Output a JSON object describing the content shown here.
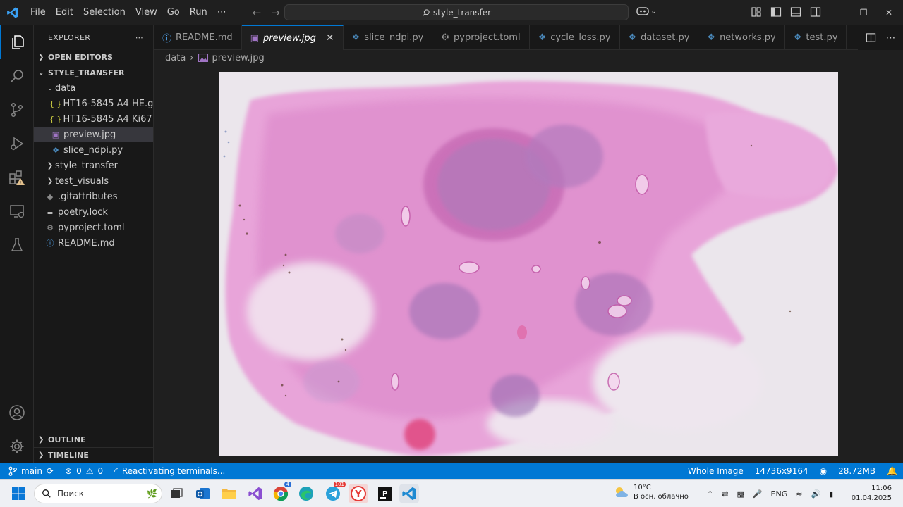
{
  "menu": [
    "File",
    "Edit",
    "Selection",
    "View",
    "Go",
    "Run",
    "⋯"
  ],
  "command_center": {
    "text": "style_transfer"
  },
  "explorer": {
    "title": "EXPLORER",
    "more": "⋯",
    "open_editors": "OPEN EDITORS",
    "root": "STYLE_TRANSFER",
    "tree": [
      {
        "label": "data",
        "kind": "folder-open",
        "indent": 1
      },
      {
        "label": "HT16-5845 A4 HE.g...",
        "kind": "json",
        "indent": 2
      },
      {
        "label": "HT16-5845 A4 Ki67....",
        "kind": "json",
        "indent": 2
      },
      {
        "label": "preview.jpg",
        "kind": "image",
        "indent": 2,
        "selected": true
      },
      {
        "label": "slice_ndpi.py",
        "kind": "python",
        "indent": 2
      },
      {
        "label": "style_transfer",
        "kind": "folder",
        "indent": 1
      },
      {
        "label": "test_visuals",
        "kind": "folder",
        "indent": 1
      },
      {
        "label": ".gitattributes",
        "kind": "git",
        "indent": 1
      },
      {
        "label": "poetry.lock",
        "kind": "lock",
        "indent": 1
      },
      {
        "label": "pyproject.toml",
        "kind": "gear",
        "indent": 1
      },
      {
        "label": "README.md",
        "kind": "info",
        "indent": 1
      }
    ],
    "outline": "OUTLINE",
    "timeline": "TIMELINE"
  },
  "tabs": [
    {
      "label": "README.md",
      "icon": "info-icon"
    },
    {
      "label": "preview.jpg",
      "icon": "image-icon",
      "active": true,
      "close": "✕"
    },
    {
      "label": "slice_ndpi.py",
      "icon": "python-icon"
    },
    {
      "label": "pyproject.toml",
      "icon": "gear-icon"
    },
    {
      "label": "cycle_loss.py",
      "icon": "python-icon"
    },
    {
      "label": "dataset.py",
      "icon": "python-icon"
    },
    {
      "label": "networks.py",
      "icon": "python-icon"
    },
    {
      "label": "test.py",
      "icon": "python-icon"
    }
  ],
  "breadcrumb": {
    "folder": "data",
    "sep": "›",
    "file": "preview.jpg"
  },
  "status": {
    "branch": "main",
    "errors": "0",
    "warnings": "0",
    "message": "Reactivating terminals...",
    "zoom": "Whole Image",
    "dimensions": "14736x9164",
    "size": "28.72MB"
  },
  "taskbar": {
    "search_placeholder": "Поиск",
    "temperature": "10°C",
    "weather_desc": "В осн. облачно",
    "lang": "ENG",
    "time": "11:06",
    "date": "01.04.2025",
    "mail_badge": "4",
    "telegram_badge": "101"
  },
  "colors": {
    "accent": "#0078d4",
    "tissue_pink": "#e07ac8",
    "tissue_purple": "#9a6fb3",
    "slide_bg": "#e9e4ea"
  }
}
